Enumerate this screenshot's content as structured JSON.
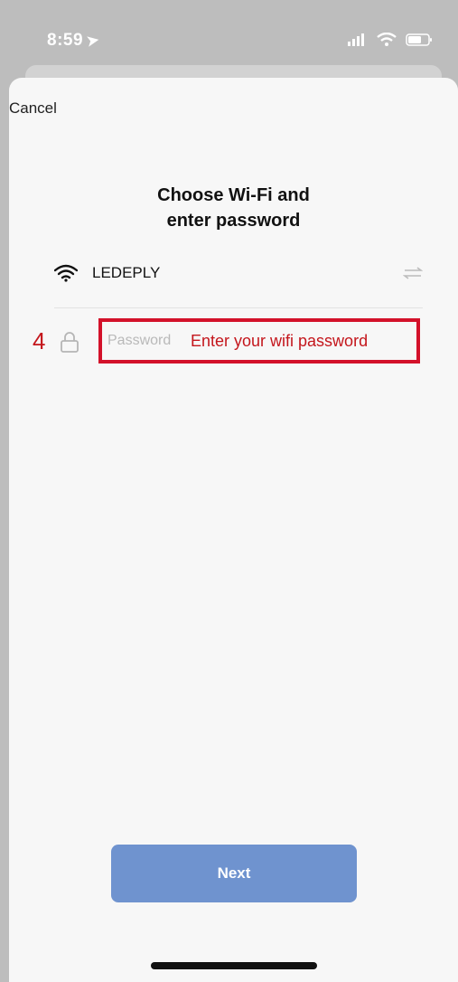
{
  "status_bar": {
    "time": "8:59"
  },
  "header": {
    "cancel_label": "Cancel"
  },
  "title": {
    "line1": "Choose Wi-Fi and",
    "line2": "enter password"
  },
  "wifi": {
    "network_name": "LEDEPLY"
  },
  "password": {
    "step_number": "4",
    "placeholder": "Password",
    "annotation": "Enter your wifi password"
  },
  "footer": {
    "next_label": "Next"
  },
  "colors": {
    "accent": "#6f93cf",
    "annotation_red": "#c4161c",
    "highlight_border": "#d3112a"
  }
}
